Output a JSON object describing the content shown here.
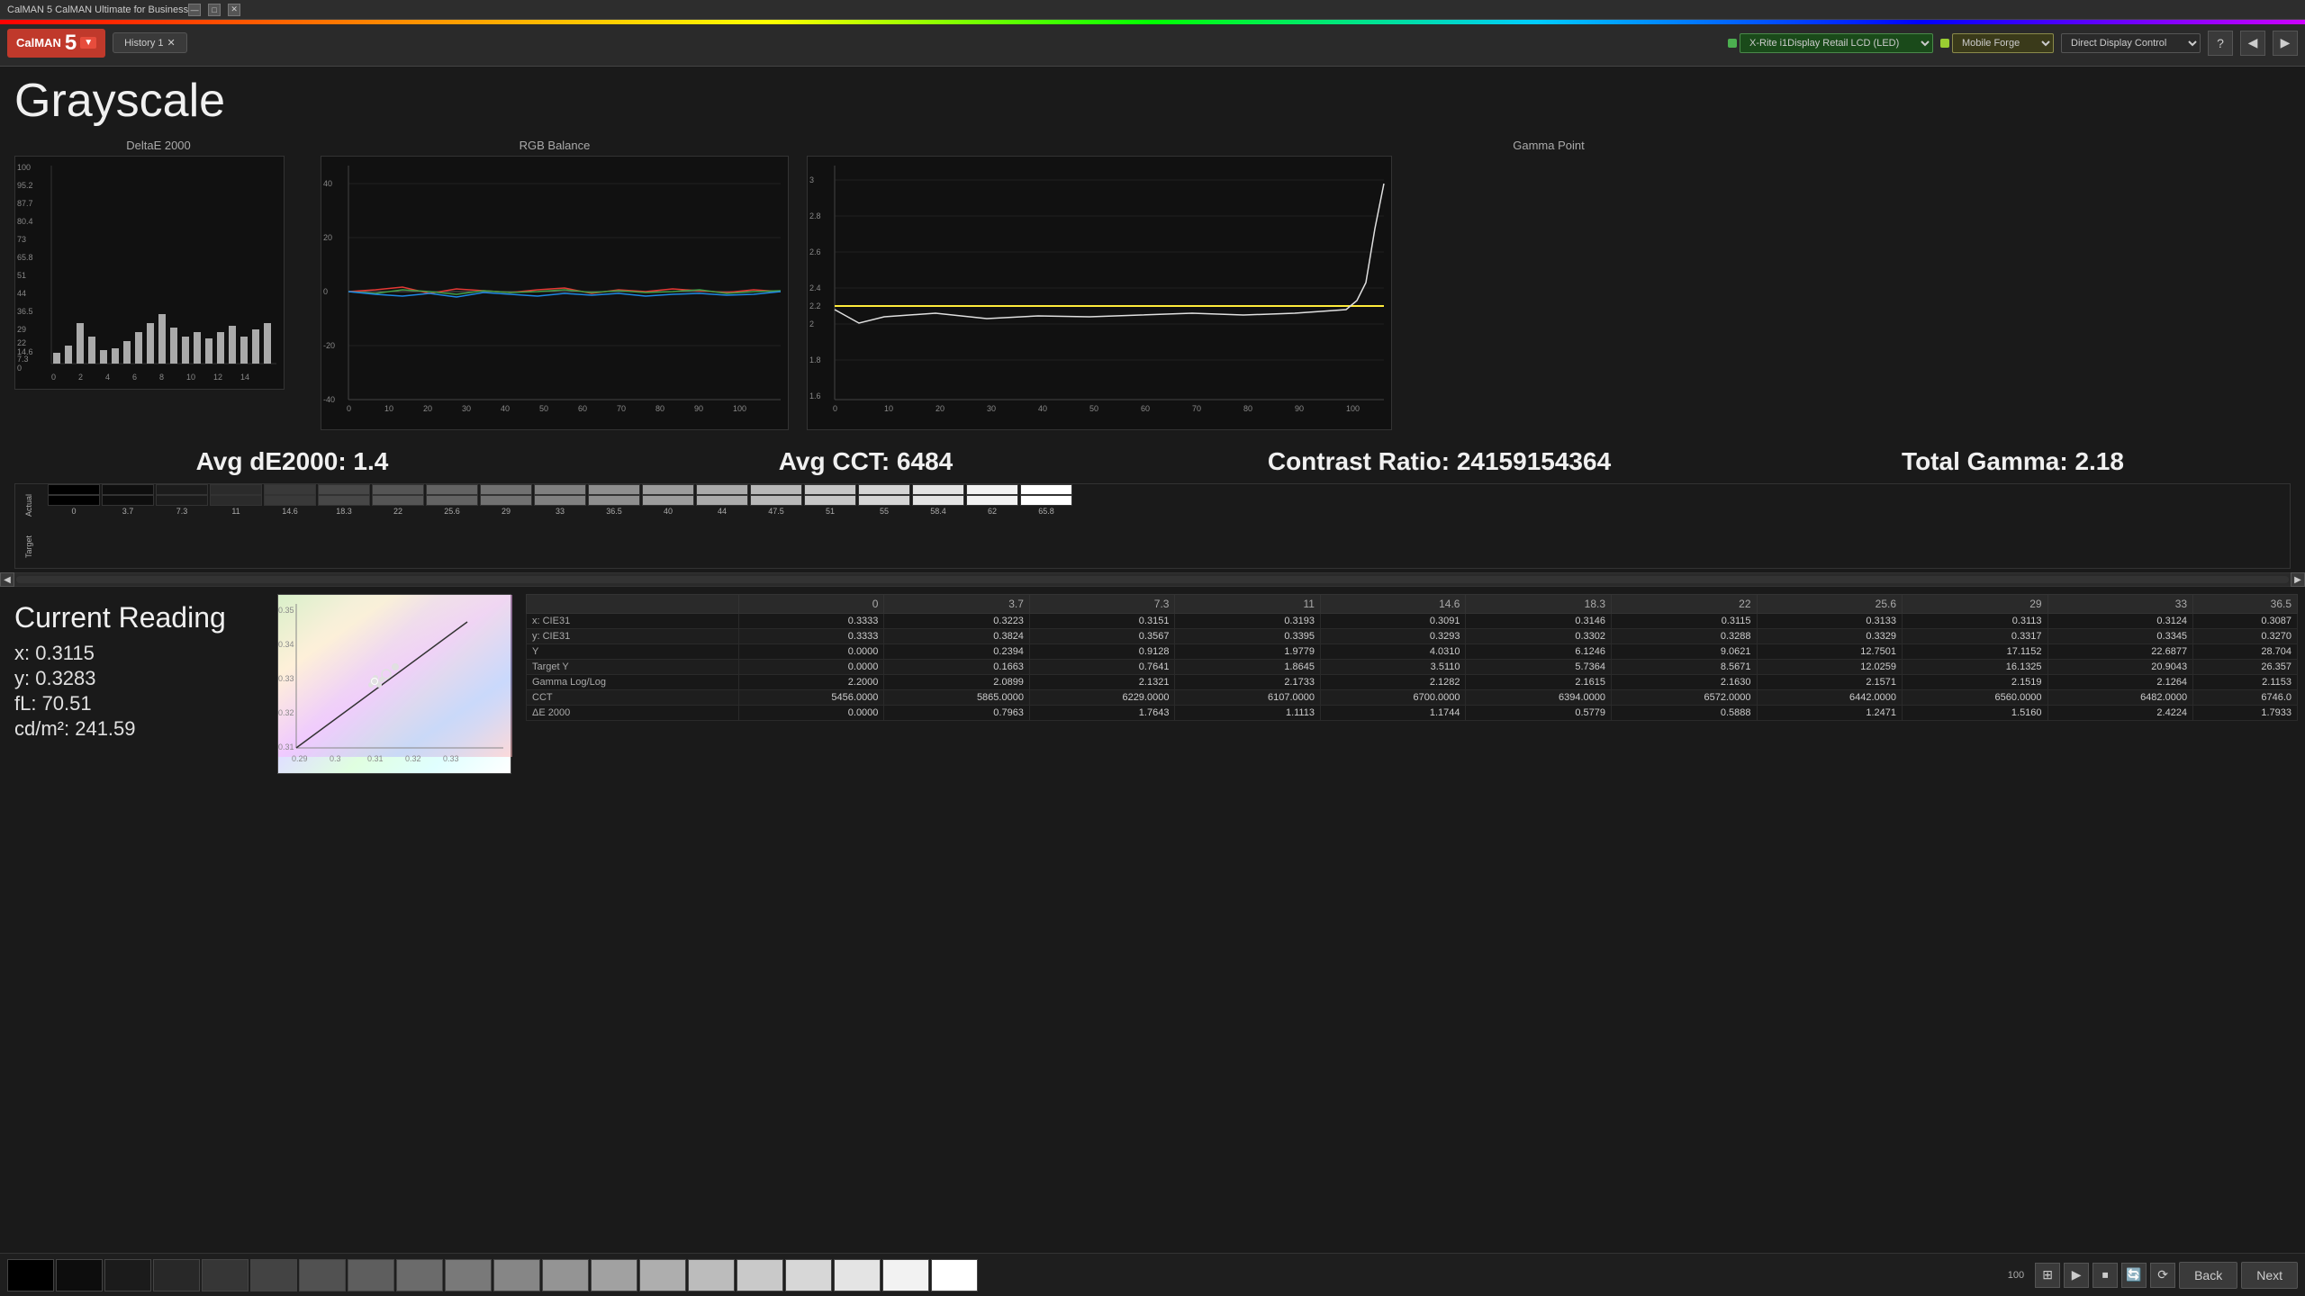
{
  "window": {
    "title": "CalMAN 5 CalMAN Ultimate for Business",
    "controls": [
      "—",
      "□",
      "✕"
    ]
  },
  "toolbar": {
    "logo": "CalMAN",
    "version": "5",
    "history_tab": "History 1",
    "devices": [
      {
        "name": "X-Rite i1Display Retail LCD (LED)",
        "color": "green"
      },
      {
        "name": "Mobile Forge",
        "color": "yellow"
      },
      {
        "name": "Direct Display Control",
        "color": "default"
      }
    ],
    "icon_buttons": [
      "?",
      "◀",
      "▶"
    ]
  },
  "page": {
    "title": "Grayscale"
  },
  "delta_chart": {
    "title": "DeltaE 2000",
    "y_labels": [
      "100",
      "95.2",
      "87.7",
      "80.4",
      "73",
      "65.8",
      "51",
      "44",
      "36.5",
      "29",
      "22",
      "14.6",
      "7.3",
      "0"
    ],
    "x_labels": [
      "0",
      "2",
      "4",
      "6",
      "8",
      "10",
      "12",
      "14"
    ]
  },
  "rgb_chart": {
    "title": "RGB Balance",
    "y_labels": [
      "40",
      "20",
      "0",
      "-20",
      "-40"
    ],
    "x_labels": [
      "0",
      "10",
      "20",
      "30",
      "40",
      "50",
      "60",
      "70",
      "80",
      "90",
      "100"
    ]
  },
  "gamma_chart": {
    "title": "Gamma Point",
    "y_labels": [
      "3",
      "2.8",
      "2.6",
      "2.4",
      "2.2",
      "2",
      "1.8",
      "1.6"
    ],
    "x_labels": [
      "0",
      "10",
      "20",
      "30",
      "40",
      "50",
      "60",
      "70",
      "80",
      "90",
      "100"
    ],
    "target_line": "2.2"
  },
  "stats": {
    "avg_de": "Avg dE2000: 1.4",
    "avg_cct": "Avg CCT: 6484",
    "contrast_ratio": "Contrast Ratio: 24159154364",
    "total_gamma": "Total Gamma: 2.18"
  },
  "swatches": {
    "labels": [
      "0",
      "3.7",
      "7.3",
      "11",
      "14.6",
      "18.3",
      "22",
      "25.6",
      "29",
      "33",
      "36.5",
      "40",
      "44",
      "47.5",
      "51",
      "55",
      "58.4",
      "62",
      "65.8"
    ],
    "row_labels": [
      "Actual",
      "Target"
    ]
  },
  "current_reading": {
    "title": "Current Reading",
    "x": "x: 0.3115",
    "y": "y: 0.3283",
    "fL": "fL: 70.51",
    "cdm2": "cd/m²: 241.59"
  },
  "cie_chart": {
    "x_labels": [
      "0.29",
      "0.3",
      "0.31",
      "0.32",
      "0.33"
    ],
    "y_labels": [
      "0.35",
      "0.34",
      "0.33",
      "0.32",
      "0.31"
    ]
  },
  "data_table": {
    "columns": [
      "",
      "0",
      "3.7",
      "7.3",
      "11",
      "14.6",
      "18.3",
      "22",
      "25.6",
      "29",
      "33",
      "36.5"
    ],
    "rows": [
      {
        "label": "x: CIE31",
        "values": [
          "0.3333",
          "0.3223",
          "0.3151",
          "0.3193",
          "0.3091",
          "0.3146",
          "0.3115",
          "0.3133",
          "0.3113",
          "0.3124",
          "0.3087"
        ]
      },
      {
        "label": "y: CIE31",
        "values": [
          "0.3333",
          "0.3824",
          "0.3567",
          "0.3395",
          "0.3293",
          "0.3302",
          "0.3288",
          "0.3329",
          "0.3317",
          "0.3345",
          "0.3270"
        ]
      },
      {
        "label": "Y",
        "values": [
          "0.0000",
          "0.2394",
          "0.9128",
          "1.9779",
          "4.0310",
          "6.1246",
          "9.0621",
          "12.7501",
          "17.1152",
          "22.6877",
          "28.704"
        ]
      },
      {
        "label": "Target Y",
        "values": [
          "0.0000",
          "0.1663",
          "0.7641",
          "1.8645",
          "3.5110",
          "5.7364",
          "8.5671",
          "12.0259",
          "16.1325",
          "20.9043",
          "26.357"
        ]
      },
      {
        "label": "Gamma Log/Log",
        "values": [
          "2.2000",
          "2.0899",
          "2.1321",
          "2.1733",
          "2.1282",
          "2.1615",
          "2.1630",
          "2.1571",
          "2.1519",
          "2.1264",
          "2.1153"
        ]
      },
      {
        "label": "CCT",
        "values": [
          "5456.0000",
          "5865.0000",
          "6229.0000",
          "6107.0000",
          "6700.0000",
          "6394.0000",
          "6572.0000",
          "6442.0000",
          "6560.0000",
          "6482.0000",
          "6746.0"
        ]
      },
      {
        "label": "ΔE 2000",
        "values": [
          "0.0000",
          "0.7963",
          "1.7643",
          "1.1113",
          "1.1744",
          "0.5779",
          "0.5888",
          "1.2471",
          "1.5160",
          "2.4224",
          "1.7933"
        ]
      }
    ]
  },
  "taskbar": {
    "swatch_count": 20,
    "buttons": [
      "Back",
      "Next"
    ],
    "percent": "100"
  }
}
